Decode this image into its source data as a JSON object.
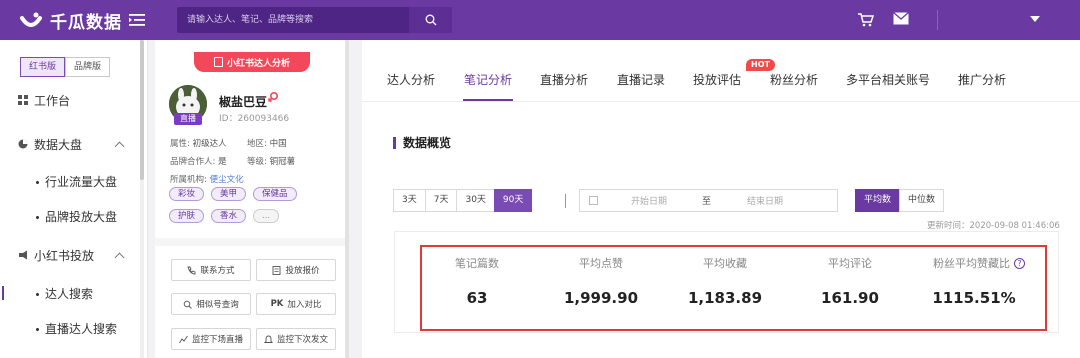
{
  "app": {
    "name": "千瓜数据"
  },
  "search": {
    "placeholder": "请输入达人、笔记、品牌等搜索"
  },
  "sidebar": {
    "versions": [
      "红书版",
      "品牌版"
    ],
    "items": [
      {
        "label": "工作台",
        "icon": "grid-icon"
      },
      {
        "label": "数据大盘",
        "icon": "pie-chart-icon"
      },
      {
        "label": "小红书投放",
        "icon": "megaphone-icon"
      }
    ],
    "sub_items": {
      "dashboard": [
        "行业流量大盘",
        "品牌投放大盘"
      ],
      "placement": [
        "达人搜索",
        "直播达人搜索"
      ]
    }
  },
  "card": {
    "badge": "小红书达人分析",
    "live": "直播",
    "name": "椒盐巴豆",
    "id": "ID：260093466",
    "attr_label": "属性:",
    "attr_value": "初级达人",
    "region_label": "地区:",
    "region_value": "中国",
    "brand_label": "品牌合作人:",
    "brand_value": "是",
    "level_label": "等级:",
    "level_value": "铜冠薯",
    "org_label": "所属机构:",
    "org_value": "便尘文化",
    "tags": [
      "彩妆",
      "美甲",
      "保健品",
      "护肤",
      "香水",
      "..."
    ],
    "actions": [
      "联系方式",
      "投放报价",
      "相似号查询",
      "加入对比",
      "监控下场直播",
      "监控下次发文"
    ]
  },
  "tabs": {
    "items": [
      "达人分析",
      "笔记分析",
      "直播分析",
      "直播记录",
      "投放评估",
      "粉丝分析",
      "多平台相关账号",
      "推广分析"
    ],
    "active": "笔记分析",
    "hot": "HOT"
  },
  "overview": {
    "title": "数据概览",
    "ranges": [
      "3天",
      "7天",
      "30天",
      "90天"
    ],
    "active_range": "90天",
    "date_start": "开始日期",
    "date_to": "至",
    "date_end": "结束日期",
    "modes": [
      "平均数",
      "中位数"
    ],
    "updated": "更新时间：2020-09-08 01:46:06",
    "stats": [
      {
        "label": "笔记篇数",
        "value": "63"
      },
      {
        "label": "平均点赞",
        "value": "1,999.90"
      },
      {
        "label": "平均收藏",
        "value": "1,183.89"
      },
      {
        "label": "平均评论",
        "value": "161.90"
      },
      {
        "label": "粉丝平均赞藏比",
        "value": "1115.51%"
      }
    ]
  },
  "colors": {
    "brand": "#6a3aa2",
    "highlight": "#e03a3a",
    "badge": "#f2485a"
  }
}
